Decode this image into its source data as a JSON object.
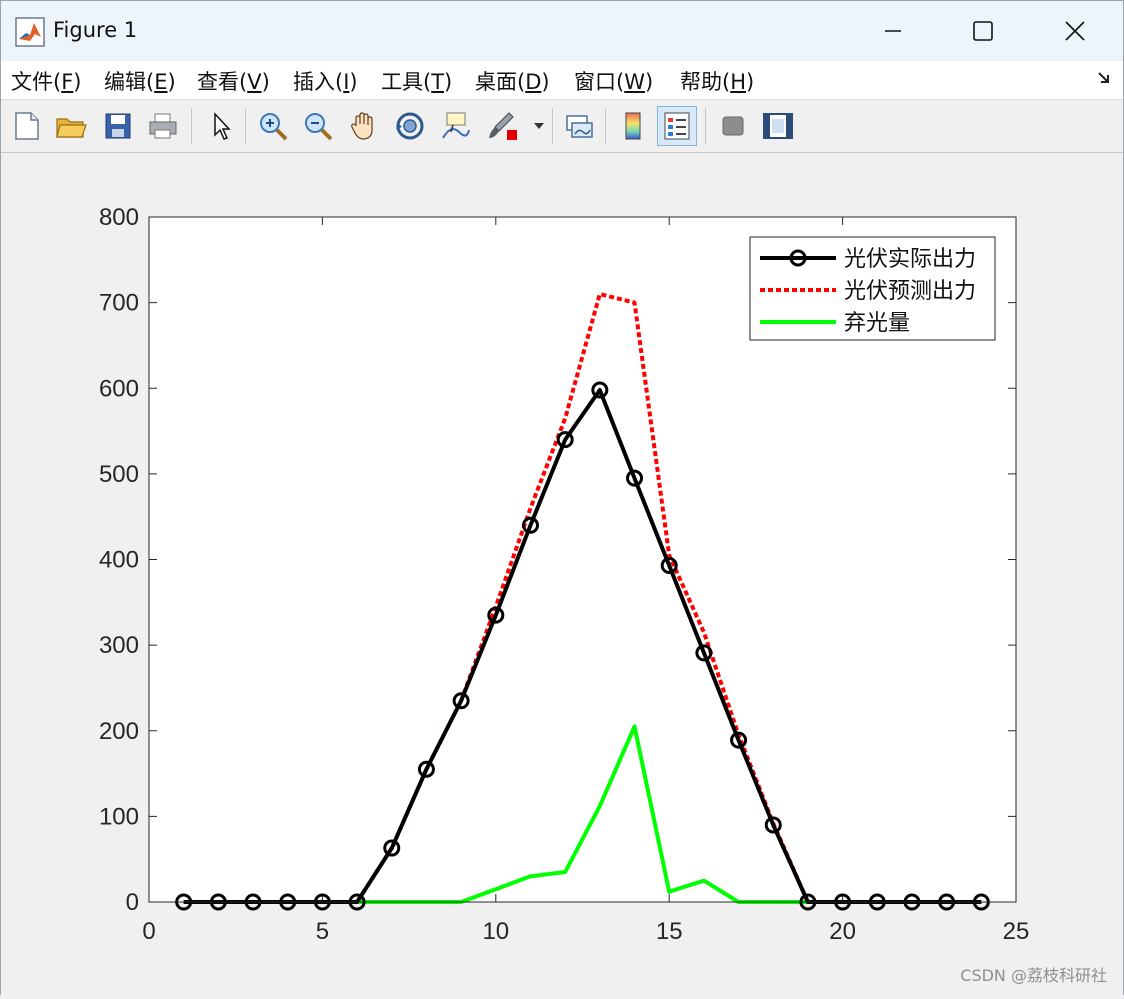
{
  "window": {
    "title": "Figure 1",
    "icon": "matlab-icon",
    "controls": [
      "minimize-icon",
      "maximize-icon",
      "close-icon"
    ]
  },
  "menu": {
    "items": [
      {
        "label": "文件(",
        "key": "F",
        "suffix": ")"
      },
      {
        "label": "编辑(",
        "key": "E",
        "suffix": ")"
      },
      {
        "label": "查看(",
        "key": "V",
        "suffix": ")"
      },
      {
        "label": "插入(",
        "key": "I",
        "suffix": ")"
      },
      {
        "label": "工具(",
        "key": "T",
        "suffix": ")"
      },
      {
        "label": "桌面(",
        "key": "D",
        "suffix": ")"
      },
      {
        "label": "窗口(",
        "key": "W",
        "suffix": ")"
      },
      {
        "label": "帮助(",
        "key": "H",
        "suffix": ")"
      }
    ]
  },
  "toolbar": {
    "icons": [
      "new-figure-icon",
      "open-file-icon",
      "save-icon",
      "print-icon",
      "pointer-icon",
      "zoom-in-icon",
      "zoom-out-icon",
      "pan-hand-icon",
      "rotate-3d-icon",
      "data-cursor-icon",
      "brush-icon",
      "brush-dropdown-icon",
      "link-plot-icon",
      "colorbar-icon",
      "legend-icon",
      "hide-plot-tools-icon",
      "show-plot-tools-icon"
    ],
    "active": "legend-icon"
  },
  "chart_data": {
    "type": "line",
    "xlim": [
      0,
      25
    ],
    "ylim": [
      0,
      800
    ],
    "xticks": [
      0,
      5,
      10,
      15,
      20,
      25
    ],
    "yticks": [
      0,
      100,
      200,
      300,
      400,
      500,
      600,
      700,
      800
    ],
    "grid": false,
    "legend_position": "top-right",
    "x": [
      1,
      2,
      3,
      4,
      5,
      6,
      7,
      8,
      9,
      10,
      11,
      12,
      13,
      14,
      15,
      16,
      17,
      18,
      19,
      20,
      21,
      22,
      23,
      24
    ],
    "series": [
      {
        "name": "光伏实际出力",
        "color": "#000000",
        "style": "solid-circle-markers",
        "values": [
          0,
          0,
          0,
          0,
          0,
          0,
          63,
          155,
          235,
          335,
          440,
          540,
          598,
          495,
          393,
          291,
          189,
          90,
          0,
          0,
          0,
          0,
          0,
          0
        ]
      },
      {
        "name": "光伏预测出力",
        "color": "#ff0000",
        "style": "dotted",
        "values": [
          0,
          0,
          0,
          0,
          0,
          0,
          63,
          155,
          235,
          345,
          460,
          565,
          710,
          700,
          405,
          315,
          195,
          92,
          0,
          0,
          0,
          0,
          0,
          0
        ]
      },
      {
        "name": "弃光量",
        "color": "#00ff00",
        "style": "solid",
        "values": [
          0,
          0,
          0,
          0,
          0,
          0,
          0,
          0,
          0,
          15,
          30,
          35,
          112,
          205,
          12,
          25,
          0,
          0,
          0,
          0,
          0,
          0,
          0,
          0
        ]
      }
    ]
  },
  "watermark": "CSDN @荔枝科研社"
}
